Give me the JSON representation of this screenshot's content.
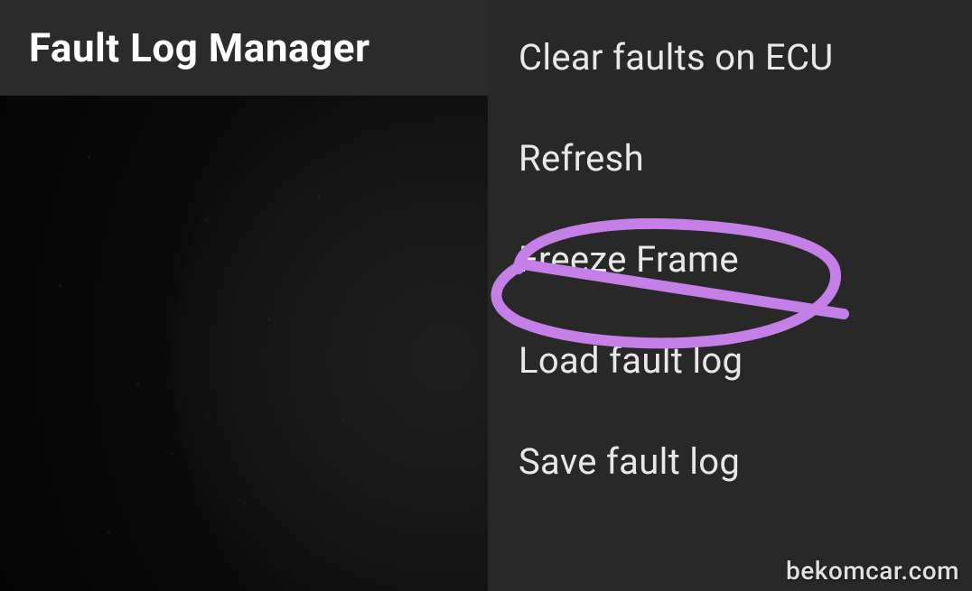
{
  "header": {
    "title": "Fault Log Manager"
  },
  "menu": {
    "items": [
      {
        "label": "Clear faults on ECU"
      },
      {
        "label": "Refresh"
      },
      {
        "label": "Freeze Frame"
      },
      {
        "label": "Load fault log"
      },
      {
        "label": "Save fault log"
      }
    ]
  },
  "annotation": {
    "circled_item": "Freeze Frame",
    "color": "#c580e8"
  },
  "watermark": {
    "text": "bekomcar.com"
  }
}
